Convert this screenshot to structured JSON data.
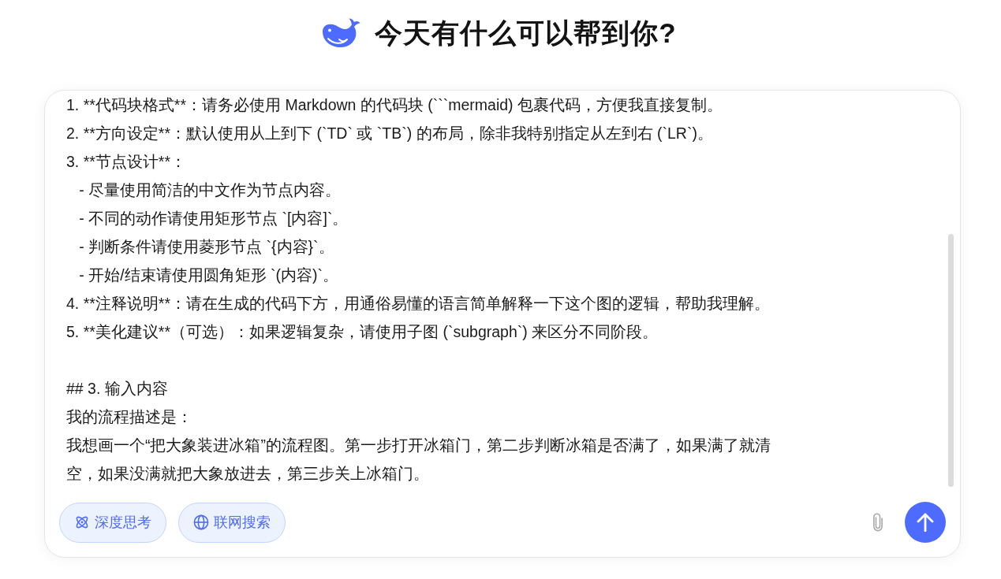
{
  "header": {
    "title": "今天有什么可以帮到你?"
  },
  "composer": {
    "input": {
      "paragraphs": [
        [
          "1. **代码块格式**：请务必使用 Markdown 的代码块 (```mermaid) 包裹代码，方便我直接复制。",
          "2. **方向设定**：默认使用从上到下 (`TD` 或 `TB`) 的布局，除非我特别指定从左到右 (`LR`)。",
          "3. **节点设计**：",
          "   - 尽量使用简洁的中文作为节点内容。",
          "   - 不同的动作请使用矩形节点 `[内容]`。",
          "   - 判断条件请使用菱形节点 `{内容}`。",
          "   - 开始/结束请使用圆角矩形 `(内容)`。",
          "4. **注释说明**：请在生成的代码下方，用通俗易懂的语言简单解释一下这个图的逻辑，帮助我理解。",
          "5. **美化建议**（可选）：如果逻辑复杂，请使用子图 (`subgraph`) 来区分不同阶段。"
        ],
        [
          "## 3. 输入内容",
          "我的流程描述是：",
          "我想画一个“把大象装进冰箱”的流程图。第一步打开冰箱门，第二步判断冰箱是否满了，如果满了就清",
          "空，如果没满就把大象放进去，第三步关上冰箱门。"
        ]
      ]
    },
    "toggles": [
      {
        "label": "深度思考",
        "kind": "deep-think",
        "selected": true
      },
      {
        "label": "联网搜索",
        "kind": "web-search",
        "selected": true
      }
    ]
  }
}
